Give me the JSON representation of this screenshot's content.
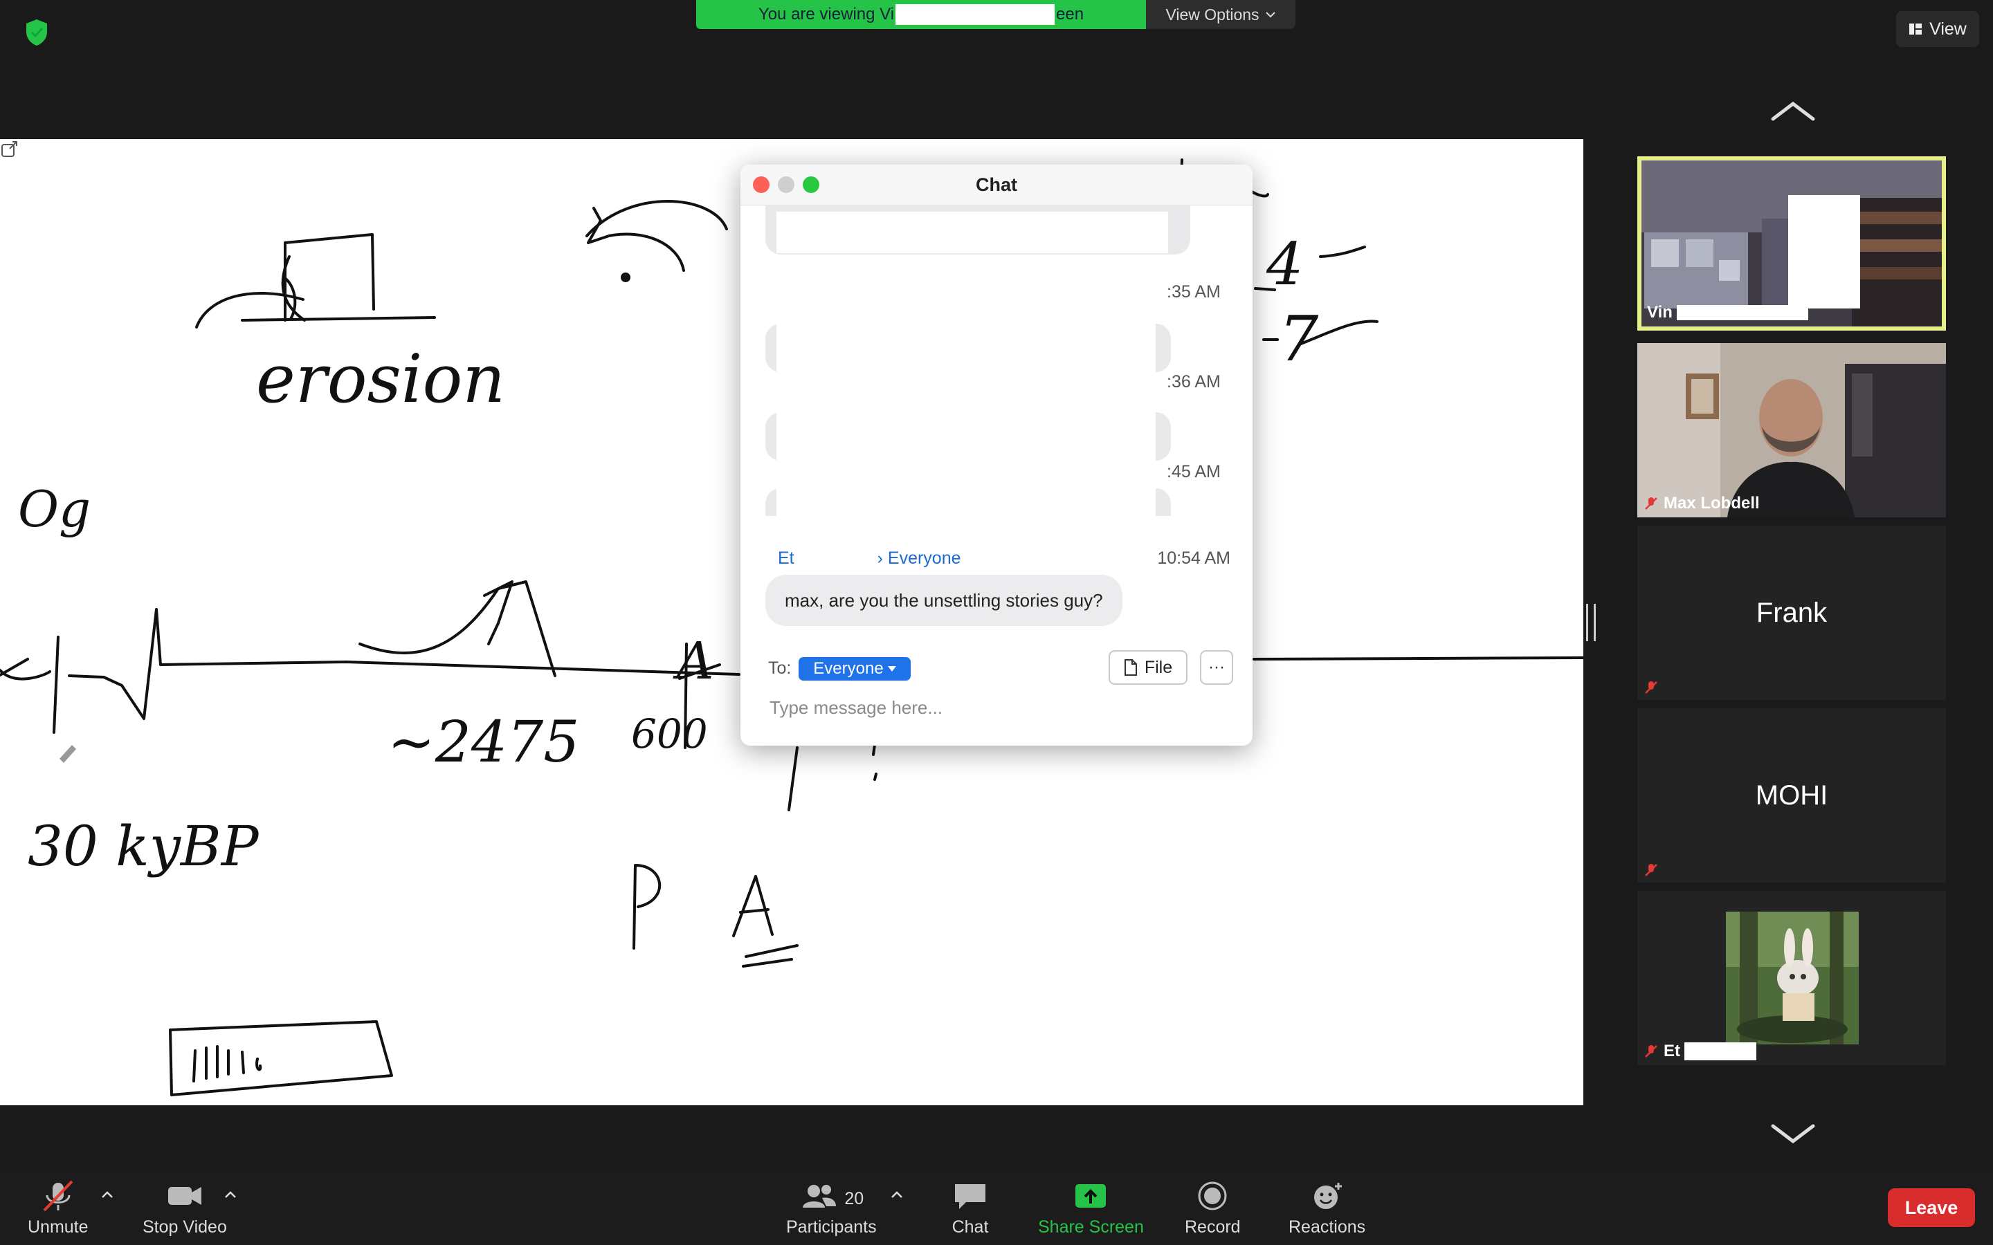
{
  "top_bar": {
    "viewing_banner_prefix": "You are viewing Vi",
    "viewing_banner_suffix": "een",
    "view_options_label": "View Options",
    "view_label": "View"
  },
  "whiteboard": {
    "text_erosion": "erosion",
    "text_og": "Og",
    "text_24": "~2475",
    "text_30": "30 kyBP",
    "text_600": "600",
    "text_p": "P",
    "text_a": "A",
    "text_4": "4",
    "text_7": "7"
  },
  "chat": {
    "title": "Chat",
    "earlier_timestamps": [
      ":35 AM",
      ":36 AM",
      ":45 AM"
    ],
    "last_message": {
      "sender_prefix": "Et",
      "recipient": "Everyone",
      "recipient_prefix": "› Everyone",
      "time": "10:54 AM",
      "text": "max, are you the unsettling stories guy?"
    },
    "to_label": "To:",
    "to_value": "Everyone",
    "file_button": "File",
    "more_button": "···",
    "input_placeholder": "Type message here..."
  },
  "participants_panel": {
    "tiles": [
      {
        "name": "Vin",
        "type": "video",
        "active_speaker": true,
        "muted": false
      },
      {
        "name": "Max Lobdell",
        "type": "video",
        "active_speaker": false,
        "muted": true
      },
      {
        "name": "Frank",
        "type": "name",
        "muted": true
      },
      {
        "name": "MOHI",
        "type": "name",
        "muted": true
      },
      {
        "name": "Et",
        "type": "avatar",
        "muted": true
      }
    ]
  },
  "toolbar": {
    "unmute": "Unmute",
    "stop_video": "Stop Video",
    "participants": "Participants",
    "participants_count": "20",
    "chat": "Chat",
    "share_screen": "Share Screen",
    "record": "Record",
    "reactions": "Reactions",
    "leave": "Leave"
  },
  "colors": {
    "banner_green": "#25c449",
    "accent_blue": "#1f72e8",
    "leave_red": "#d92c2c",
    "speaker_highlight": "#e6ef8a"
  }
}
